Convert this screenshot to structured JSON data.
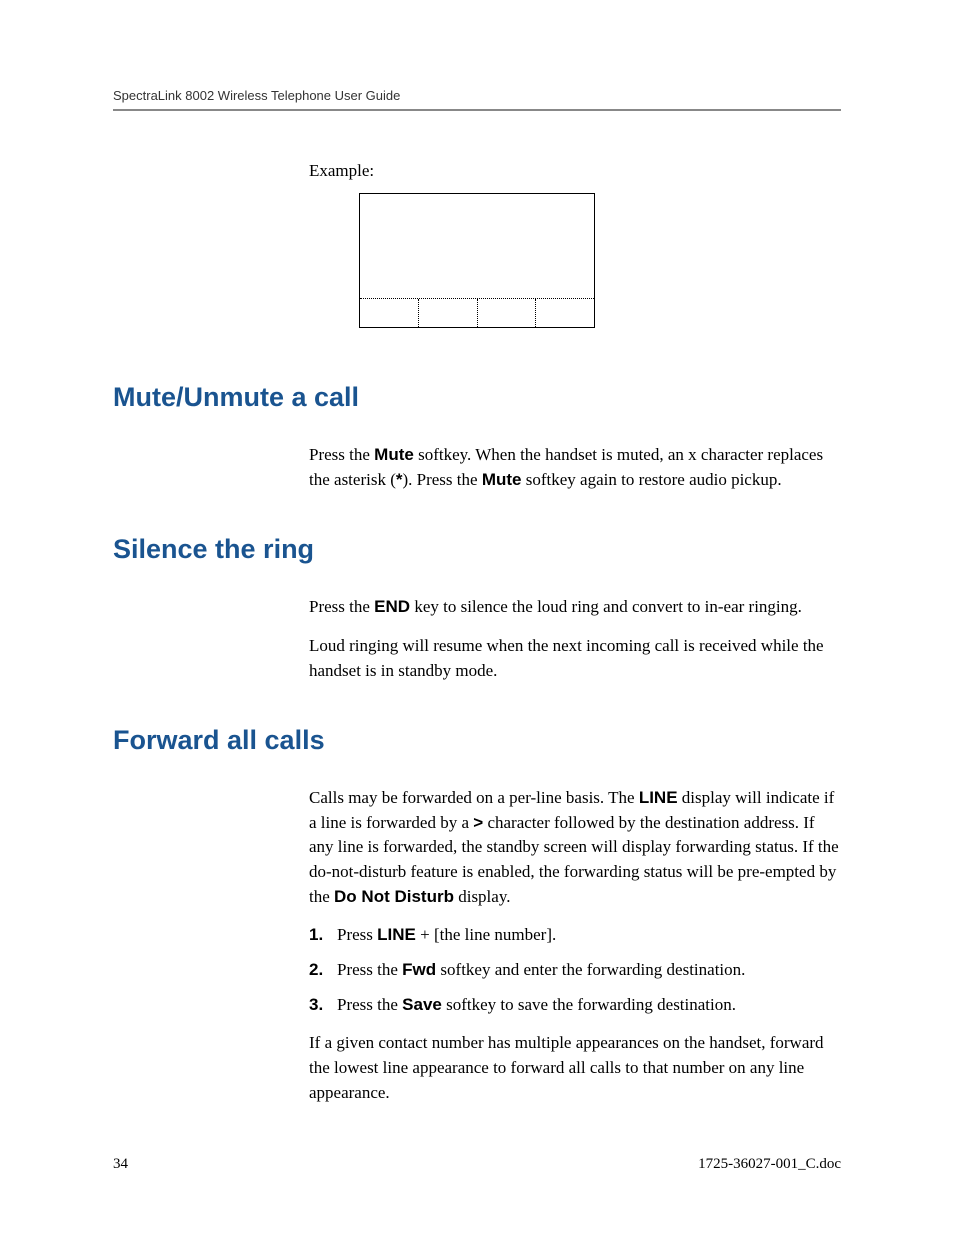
{
  "header": {
    "title": "SpectraLink 8002 Wireless Telephone User Guide"
  },
  "example_label": "Example:",
  "sections": {
    "mute": {
      "heading": "Mute/Unmute a call",
      "para_parts": {
        "t1": "Press the ",
        "b1": "Mute",
        "t2": " softkey. When the handset is muted, an x character replaces the asterisk (",
        "b2": "*",
        "t3": "). Press the ",
        "b3": "Mute",
        "t4": " softkey again to restore audio pickup."
      }
    },
    "silence": {
      "heading": "Silence the ring",
      "para1_parts": {
        "t1": "Press the ",
        "b1": "END",
        "t2": " key to silence the loud ring and convert to in-ear ringing."
      },
      "para2": "Loud ringing will resume when the next incoming call is received while the handset is in standby mode."
    },
    "forward": {
      "heading": "Forward all calls",
      "intro_parts": {
        "t1": "Calls may be forwarded on a per-line basis. The ",
        "b1": "LINE",
        "t2": " display will indicate if a line is forwarded by a ",
        "b2": ">",
        "t3": " character followed by the destination address. If any line is forwarded, the standby screen will display forwarding status. If the do-not-disturb feature is enabled, the forwarding status will be pre-empted by the ",
        "b3": "Do Not Disturb",
        "t4": " display."
      },
      "steps": {
        "s1": {
          "num": "1.",
          "t1": "Press ",
          "b1": "LINE",
          "t2": " + [the line number]."
        },
        "s2": {
          "num": "2.",
          "t1": "Press the ",
          "b1": "Fwd",
          "t2": " softkey and enter the forwarding destination."
        },
        "s3": {
          "num": "3.",
          "t1": "Press the ",
          "b1": "Save",
          "t2": " softkey to save the forwarding destination."
        }
      },
      "outro": "If a given contact number has multiple appearances on the handset, forward the lowest line appearance to forward all calls to that number on any line appearance."
    }
  },
  "footer": {
    "page_number": "34",
    "doc_ref": "1725-36027-001_C.doc"
  }
}
